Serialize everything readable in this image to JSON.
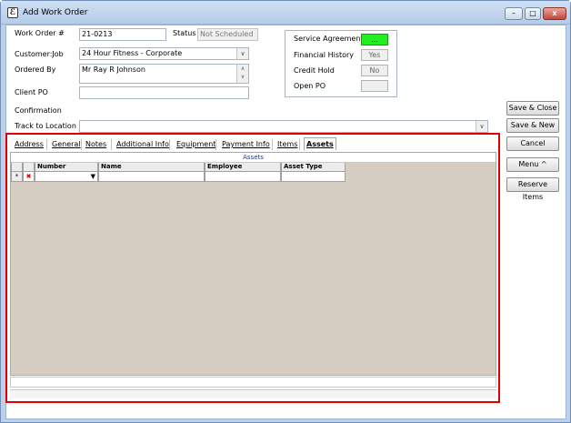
{
  "window": {
    "title": "Add Work Order",
    "app_icon": "app-logo-icon",
    "controls": {
      "minimize": "–",
      "maximize": "□",
      "close": "x"
    }
  },
  "form": {
    "work_order": {
      "label": "Work Order #",
      "value": "21-0213"
    },
    "status": {
      "label": "Status",
      "value": "Not Scheduled"
    },
    "customer_job": {
      "label": "Customer:Job",
      "value": "24 Hour Fitness - Corporate"
    },
    "ordered_by": {
      "label": "Ordered By",
      "value": "Mr Ray R Johnson"
    },
    "client_po": {
      "label": "Client PO",
      "value": ""
    },
    "confirmation": {
      "label": "Confirmation"
    },
    "track_to_location": {
      "label": "Track to Location",
      "value": ""
    }
  },
  "service_panel": {
    "service_agreement": {
      "label": "Service Agreement",
      "value": "...",
      "color": "#22ee22"
    },
    "financial_history": {
      "label": "Financial History",
      "value": "Yes"
    },
    "credit_hold": {
      "label": "Credit Hold",
      "value": "No"
    },
    "open_po": {
      "label": "Open PO",
      "value": ""
    }
  },
  "side_buttons": {
    "save_close": "Save & Close",
    "save_new": "Save & New",
    "cancel": "Cancel",
    "menu": "Menu ^",
    "reserve_items": "Reserve Items"
  },
  "tabs": [
    {
      "label": "Address"
    },
    {
      "label": "General"
    },
    {
      "label": "Notes"
    },
    {
      "label": "Additional Info"
    },
    {
      "label": "Equipment"
    },
    {
      "label": "Payment Info"
    },
    {
      "label": "Items"
    },
    {
      "label": "Assets",
      "active": true
    }
  ],
  "assets_grid": {
    "caption": "Assets",
    "columns": [
      "Number",
      "Name",
      "Employee",
      "Asset Type"
    ],
    "new_row_marker": "*",
    "delete_marker": "✖",
    "background_color": "#d6cdc3"
  },
  "highlight": {
    "color": "#e00000"
  }
}
